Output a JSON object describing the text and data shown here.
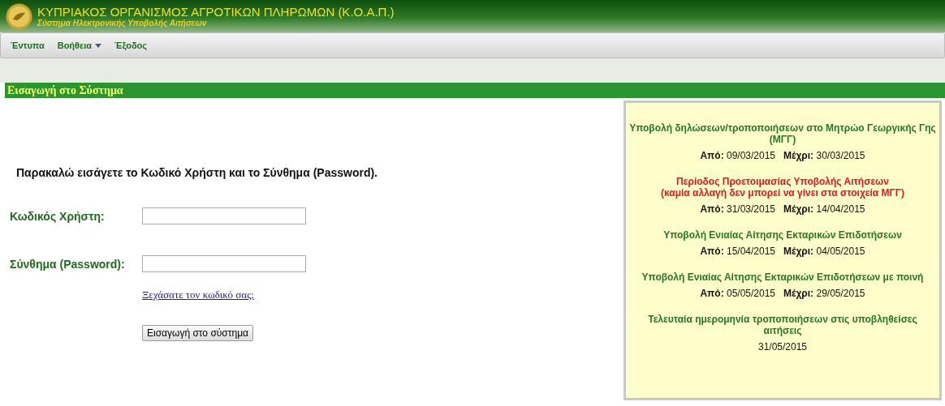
{
  "header": {
    "title": "ΚΥΠΡΙΑΚΟΣ ΟΡΓΑΝΙΣΜΟΣ ΑΓΡΟΤΙΚΩΝ ΠΛΗΡΩΜΩΝ (Κ.Ο.Α.Π.)",
    "subtitle": "Σύστημα Ηλεκτρονικής Υποβολής Αιτήσεων"
  },
  "menu": [
    {
      "label": "Έντυπα",
      "dropdown": false
    },
    {
      "label": "Βοήθεια",
      "dropdown": true
    },
    {
      "label": "Έξοδος",
      "dropdown": false
    }
  ],
  "section_title": "Εισαγωγή στο Σύστημα",
  "login": {
    "instruction": "Παρακαλώ εισάγετε το Κωδικό Χρήστη και το Σύνθημα (Password).",
    "fields": [
      {
        "label": "Κωδικός Χρήστη:"
      },
      {
        "label": "Σύνθημα (Password):"
      }
    ],
    "forgot_link": "Ξεχάσατε τον κωδικό σας;",
    "submit": "Εισαγωγή στο σύστημα"
  },
  "periods": [
    {
      "title": "Υποβολή δηλώσεων/τροποποιήσεων στο Μητρώο Γεωργικής Γης (ΜΓΓ)",
      "color": "#217a21",
      "dates": "**Από:** 09/03/2015   **Μέχρι:** 30/03/2015"
    },
    {
      "title": "Περίοδος Προετοιμασίας Υποβολής Αιτήσεων\n(καμία αλλαγή δεν μπορεί να γίνει στα στοιχεία ΜΓΓ)",
      "color": "#e8141c",
      "dates": "**Από:** 31/03/2015   **Μέχρι:** 14/04/2015"
    },
    {
      "title": "Υποβολή Ενιαίας Αίτησης Εκταρικών Επιδοτήσεων",
      "color": "#217a21",
      "dates": "**Από:** 15/04/2015   **Μέχρι:** 04/05/2015"
    },
    {
      "title": "Υποβολή Ενιαίας Αίτησης Εκταρικών Επιδοτήσεων με ποινή",
      "color": "#217a21",
      "dates": "**Από:** 05/05/2015   **Μέχρι:** 29/05/2015"
    },
    {
      "title": "Τελευταία ημερομηνία τροποποιήσεων στις υποβληθείσες αιτήσεις",
      "color": "#217a21",
      "dates": "31/05/2015"
    }
  ]
}
